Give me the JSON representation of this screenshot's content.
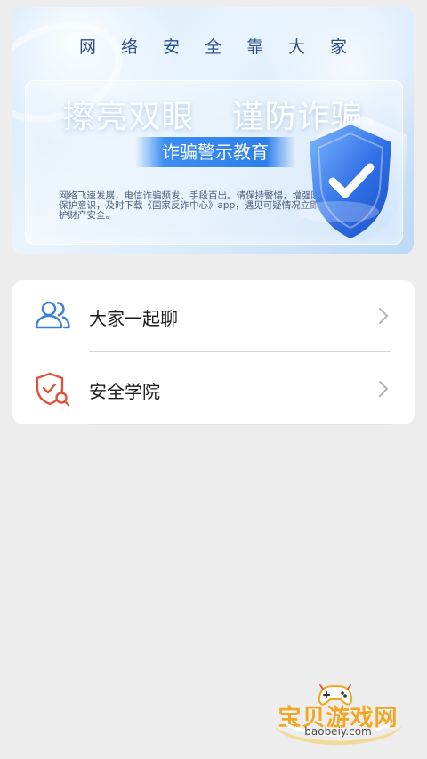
{
  "banner": {
    "slogan": "网络安全靠大家",
    "headline_left": "擦亮双眼",
    "headline_right": "谨防诈骗",
    "ribbon": "诈骗警示教育",
    "description": "网络飞速发展，电信诈骗频发、手段百出。请保持警惕，增强防范与自我保护意识，及时下载《国家反诈中心》app，遇见可疑情况立即报警，守护财产安全。"
  },
  "menu": {
    "items": [
      {
        "label": "大家一起聊",
        "icon": "users-icon"
      },
      {
        "label": "安全学院",
        "icon": "shield-search-icon"
      }
    ]
  },
  "watermark": {
    "title": "宝贝游戏网",
    "url": "baobeiy.com"
  },
  "colors": {
    "background": "#ededed",
    "card": "#ffffff",
    "users_icon": "#3a7fd5",
    "shield_icon": "#e0523a",
    "watermark_gold": "#f2a623"
  }
}
